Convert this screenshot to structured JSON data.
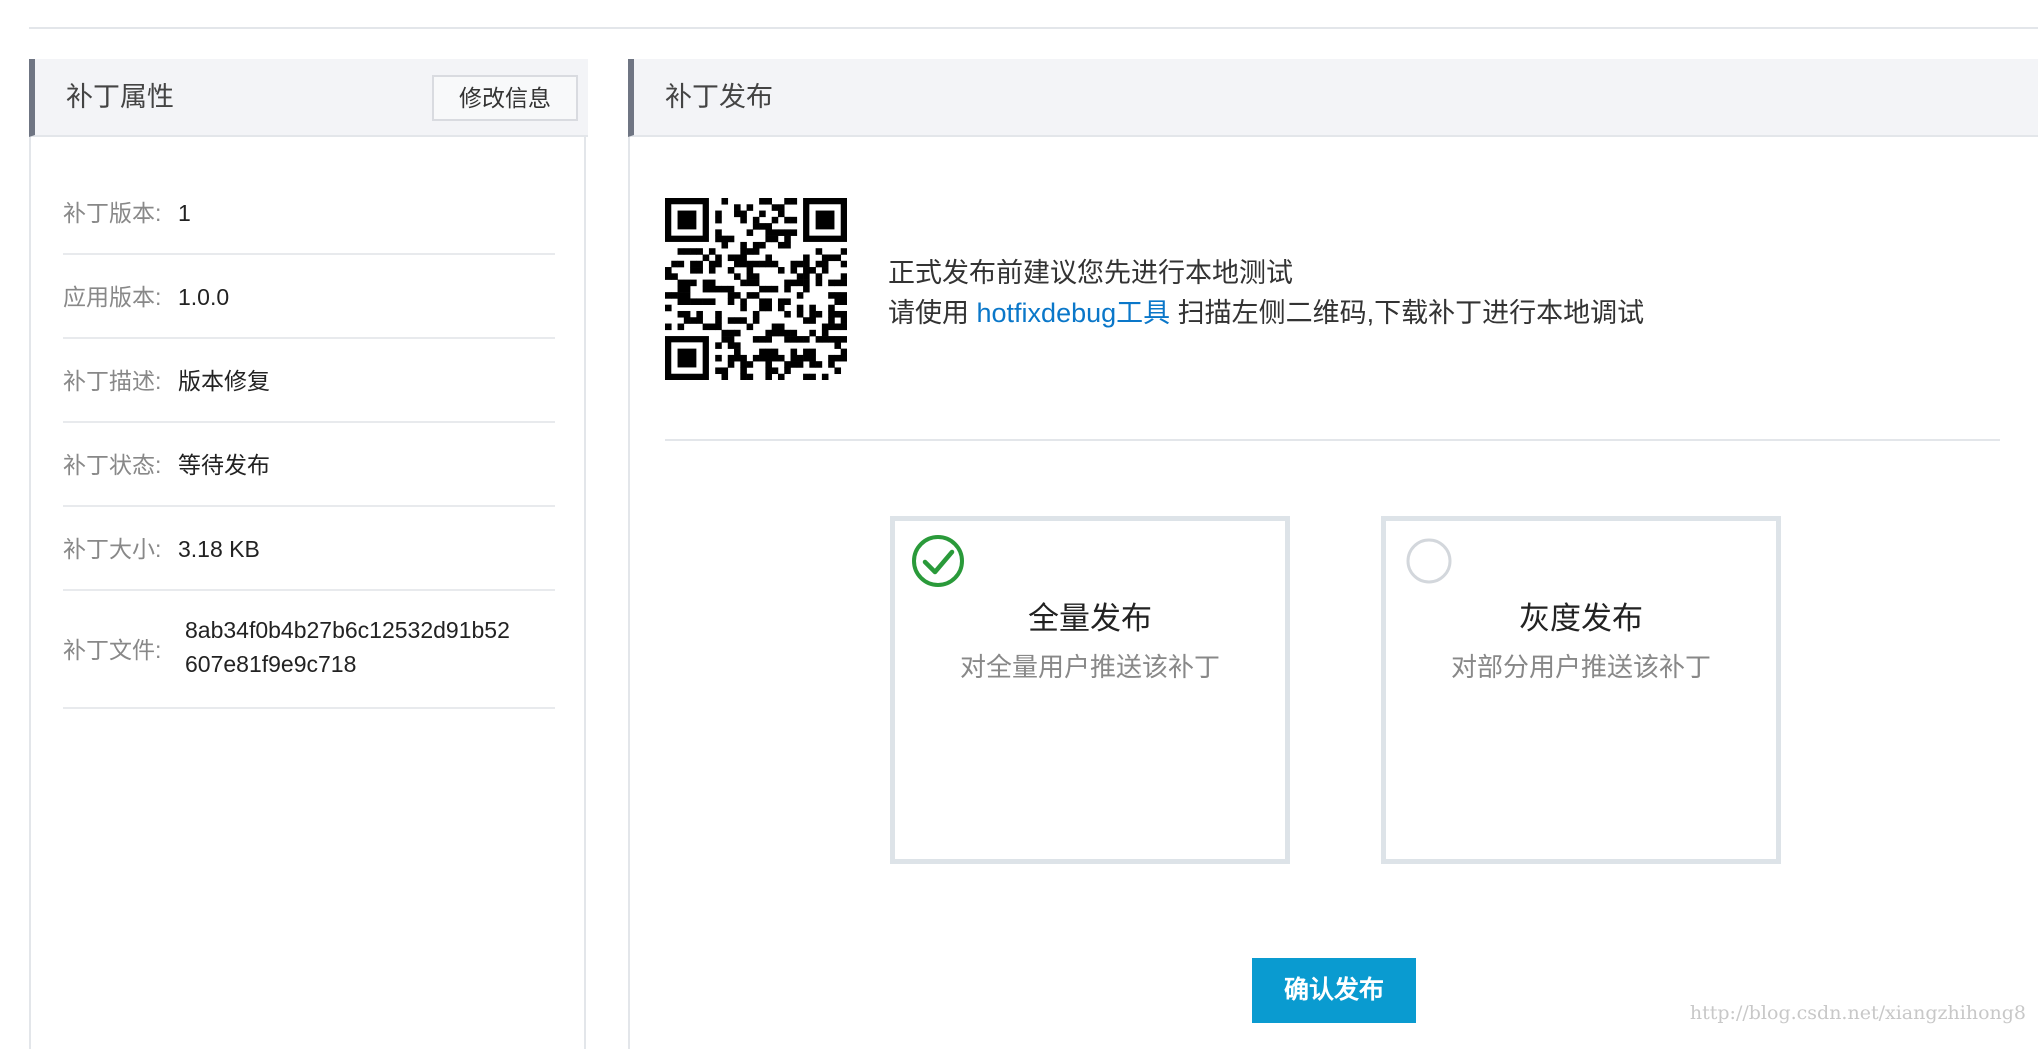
{
  "left_panel": {
    "title": "补丁属性",
    "edit_button": "修改信息",
    "properties": [
      {
        "label": "补丁版本:",
        "value": "1"
      },
      {
        "label": "应用版本:",
        "value": "1.0.0"
      },
      {
        "label": "补丁描述:",
        "value": "版本修复"
      },
      {
        "label": "补丁状态:",
        "value": "等待发布"
      },
      {
        "label": "补丁大小:",
        "value": "3.18 KB"
      },
      {
        "label": "补丁文件:",
        "value": "8ab34f0b4b27b6c12532d91b52607e81f9e9c718"
      }
    ]
  },
  "right_panel": {
    "title": "补丁发布",
    "qr_icon": "qr-code-icon",
    "hint_line1": "正式发布前建议您先进行本地测试",
    "hint_line2_prefix": "请使用",
    "hint_link": "hotfixdebug工具",
    "hint_line2_suffix": "扫描左侧二维码,下载补丁进行本地调试",
    "options": [
      {
        "title": "全量发布",
        "subtitle": "对全量用户推送该补丁",
        "selected": true
      },
      {
        "title": "灰度发布",
        "subtitle": "对部分用户推送该补丁",
        "selected": false
      }
    ],
    "confirm_button": "确认发布"
  },
  "colors": {
    "accent": "#0a9bd0",
    "link": "#0a77c9",
    "check": "#2a9a3a"
  },
  "watermark": "http://blog.csdn.net/xiangzhihong8"
}
